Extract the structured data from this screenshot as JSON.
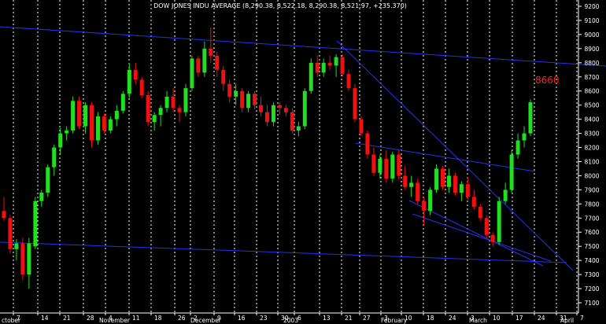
{
  "chart_data": {
    "type": "candlestick",
    "title": "DOW JONES INDU AVERAGE (8,290.38, 8,522.18, 8,290.38, 8,521.97, +235.370)",
    "colors": {
      "background": "#000000",
      "up": "#22dd22",
      "down": "#ee1111",
      "trendline": "#2233ee",
      "grid": "#ffffff",
      "annotation": "#ff2020"
    },
    "y_axis": {
      "ticks": [
        "9200",
        "9100",
        "9000",
        "8900",
        "8800",
        "8700",
        "8600",
        "8500",
        "8400",
        "8300",
        "8200",
        "8100",
        "8000",
        "7900",
        "7800",
        "7700",
        "7600",
        "7500",
        "7400",
        "7300",
        "7200",
        "7100"
      ],
      "ylim": [
        7050,
        9250
      ],
      "position": "right"
    },
    "x_axis": {
      "ticks": [
        "7",
        "14",
        "21",
        "28",
        "4",
        "11",
        "18",
        "26",
        "2",
        "9",
        "16",
        "23",
        "30",
        "6",
        "13",
        "21",
        "27",
        "3",
        "10",
        "18",
        "24",
        "3",
        "10",
        "17",
        "24",
        "31",
        "7"
      ],
      "months": [
        "ctober",
        "November",
        "December",
        "2003",
        "February",
        "March",
        "April"
      ]
    },
    "annotation": {
      "text": "8660",
      "value": 8660
    },
    "candles": [
      {
        "o": 7750,
        "h": 7850,
        "l": 7680,
        "c": 7700
      },
      {
        "o": 7700,
        "h": 7720,
        "l": 7450,
        "c": 7480
      },
      {
        "o": 7480,
        "h": 7550,
        "l": 7400,
        "c": 7520
      },
      {
        "o": 7520,
        "h": 7560,
        "l": 7260,
        "c": 7300
      },
      {
        "o": 7300,
        "h": 7560,
        "l": 7200,
        "c": 7520
      },
      {
        "o": 7500,
        "h": 7850,
        "l": 7480,
        "c": 7820
      },
      {
        "o": 7820,
        "h": 7900,
        "l": 7780,
        "c": 7880
      },
      {
        "o": 7880,
        "h": 8080,
        "l": 7850,
        "c": 8060
      },
      {
        "o": 8060,
        "h": 8220,
        "l": 8000,
        "c": 8200
      },
      {
        "o": 8200,
        "h": 8340,
        "l": 8150,
        "c": 8300
      },
      {
        "o": 8300,
        "h": 8350,
        "l": 8250,
        "c": 8320
      },
      {
        "o": 8320,
        "h": 8560,
        "l": 8300,
        "c": 8530
      },
      {
        "o": 8530,
        "h": 8560,
        "l": 8330,
        "c": 8350
      },
      {
        "o": 8350,
        "h": 8520,
        "l": 8300,
        "c": 8500
      },
      {
        "o": 8500,
        "h": 8520,
        "l": 8200,
        "c": 8250
      },
      {
        "o": 8250,
        "h": 8450,
        "l": 8220,
        "c": 8420
      },
      {
        "o": 8420,
        "h": 8440,
        "l": 8300,
        "c": 8320
      },
      {
        "o": 8320,
        "h": 8420,
        "l": 8300,
        "c": 8400
      },
      {
        "o": 8400,
        "h": 8500,
        "l": 8350,
        "c": 8460
      },
      {
        "o": 8460,
        "h": 8600,
        "l": 8440,
        "c": 8580
      },
      {
        "o": 8580,
        "h": 8800,
        "l": 8550,
        "c": 8750
      },
      {
        "o": 8750,
        "h": 8800,
        "l": 8650,
        "c": 8680
      },
      {
        "o": 8680,
        "h": 8700,
        "l": 8550,
        "c": 8570
      },
      {
        "o": 8570,
        "h": 8600,
        "l": 8350,
        "c": 8380
      },
      {
        "o": 8380,
        "h": 8450,
        "l": 8320,
        "c": 8430
      },
      {
        "o": 8430,
        "h": 8500,
        "l": 8350,
        "c": 8480
      },
      {
        "o": 8480,
        "h": 8600,
        "l": 8450,
        "c": 8560
      },
      {
        "o": 8560,
        "h": 8620,
        "l": 8450,
        "c": 8480
      },
      {
        "o": 8480,
        "h": 8500,
        "l": 8380,
        "c": 8450
      },
      {
        "o": 8450,
        "h": 8650,
        "l": 8420,
        "c": 8620
      },
      {
        "o": 8620,
        "h": 8850,
        "l": 8600,
        "c": 8830
      },
      {
        "o": 8830,
        "h": 8850,
        "l": 8700,
        "c": 8730
      },
      {
        "o": 8730,
        "h": 8950,
        "l": 8700,
        "c": 8900
      },
      {
        "o": 8900,
        "h": 9050,
        "l": 8800,
        "c": 8850
      },
      {
        "o": 8850,
        "h": 8880,
        "l": 8700,
        "c": 8750
      },
      {
        "o": 8750,
        "h": 8780,
        "l": 8600,
        "c": 8650
      },
      {
        "o": 8650,
        "h": 8680,
        "l": 8520,
        "c": 8560
      },
      {
        "o": 8560,
        "h": 8650,
        "l": 8500,
        "c": 8600
      },
      {
        "o": 8600,
        "h": 8620,
        "l": 8450,
        "c": 8480
      },
      {
        "o": 8480,
        "h": 8600,
        "l": 8450,
        "c": 8580
      },
      {
        "o": 8580,
        "h": 8600,
        "l": 8470,
        "c": 8500
      },
      {
        "o": 8500,
        "h": 8560,
        "l": 8420,
        "c": 8450
      },
      {
        "o": 8450,
        "h": 8500,
        "l": 8350,
        "c": 8380
      },
      {
        "o": 8380,
        "h": 8520,
        "l": 8350,
        "c": 8500
      },
      {
        "o": 8500,
        "h": 8520,
        "l": 8430,
        "c": 8480
      },
      {
        "o": 8480,
        "h": 8500,
        "l": 8420,
        "c": 8450
      },
      {
        "o": 8450,
        "h": 8480,
        "l": 8300,
        "c": 8320
      },
      {
        "o": 8320,
        "h": 8380,
        "l": 8280,
        "c": 8350
      },
      {
        "o": 8350,
        "h": 8620,
        "l": 8330,
        "c": 8600
      },
      {
        "o": 8600,
        "h": 8830,
        "l": 8580,
        "c": 8800
      },
      {
        "o": 8800,
        "h": 8850,
        "l": 8700,
        "c": 8730
      },
      {
        "o": 8730,
        "h": 8830,
        "l": 8700,
        "c": 8800
      },
      {
        "o": 8800,
        "h": 8850,
        "l": 8750,
        "c": 8780
      },
      {
        "o": 8780,
        "h": 8860,
        "l": 8700,
        "c": 8840
      },
      {
        "o": 8840,
        "h": 8860,
        "l": 8700,
        "c": 8720
      },
      {
        "o": 8720,
        "h": 8750,
        "l": 8600,
        "c": 8620
      },
      {
        "o": 8620,
        "h": 8650,
        "l": 8380,
        "c": 8400
      },
      {
        "o": 8400,
        "h": 8420,
        "l": 8280,
        "c": 8300
      },
      {
        "o": 8300,
        "h": 8320,
        "l": 8120,
        "c": 8150
      },
      {
        "o": 8150,
        "h": 8200,
        "l": 8000,
        "c": 8020
      },
      {
        "o": 8020,
        "h": 8150,
        "l": 7980,
        "c": 8120
      },
      {
        "o": 8120,
        "h": 8180,
        "l": 7950,
        "c": 7980
      },
      {
        "o": 7980,
        "h": 8170,
        "l": 7950,
        "c": 8150
      },
      {
        "o": 8150,
        "h": 8180,
        "l": 7970,
        "c": 8000
      },
      {
        "o": 8000,
        "h": 8070,
        "l": 7900,
        "c": 7920
      },
      {
        "o": 7920,
        "h": 8000,
        "l": 7850,
        "c": 7950
      },
      {
        "o": 7950,
        "h": 7980,
        "l": 7800,
        "c": 7820
      },
      {
        "o": 7820,
        "h": 7850,
        "l": 7650,
        "c": 7750
      },
      {
        "o": 7750,
        "h": 7920,
        "l": 7720,
        "c": 7900
      },
      {
        "o": 7900,
        "h": 8080,
        "l": 7880,
        "c": 8050
      },
      {
        "o": 8050,
        "h": 8070,
        "l": 7900,
        "c": 7920
      },
      {
        "o": 7920,
        "h": 8050,
        "l": 7880,
        "c": 8000
      },
      {
        "o": 8000,
        "h": 8020,
        "l": 7860,
        "c": 7880
      },
      {
        "o": 7880,
        "h": 7960,
        "l": 7820,
        "c": 7940
      },
      {
        "o": 7940,
        "h": 7990,
        "l": 7830,
        "c": 7850
      },
      {
        "o": 7850,
        "h": 7900,
        "l": 7760,
        "c": 7780
      },
      {
        "o": 7780,
        "h": 7800,
        "l": 7680,
        "c": 7700
      },
      {
        "o": 7700,
        "h": 7720,
        "l": 7560,
        "c": 7580
      },
      {
        "o": 7580,
        "h": 7600,
        "l": 7500,
        "c": 7530
      },
      {
        "o": 7530,
        "h": 7850,
        "l": 7510,
        "c": 7820
      },
      {
        "o": 7820,
        "h": 7950,
        "l": 7800,
        "c": 7900
      },
      {
        "o": 7900,
        "h": 8180,
        "l": 7880,
        "c": 8150
      },
      {
        "o": 8150,
        "h": 8300,
        "l": 8120,
        "c": 8250
      },
      {
        "o": 8250,
        "h": 8350,
        "l": 8200,
        "c": 8300
      },
      {
        "o": 8300,
        "h": 8540,
        "l": 8280,
        "c": 8520
      }
    ]
  }
}
